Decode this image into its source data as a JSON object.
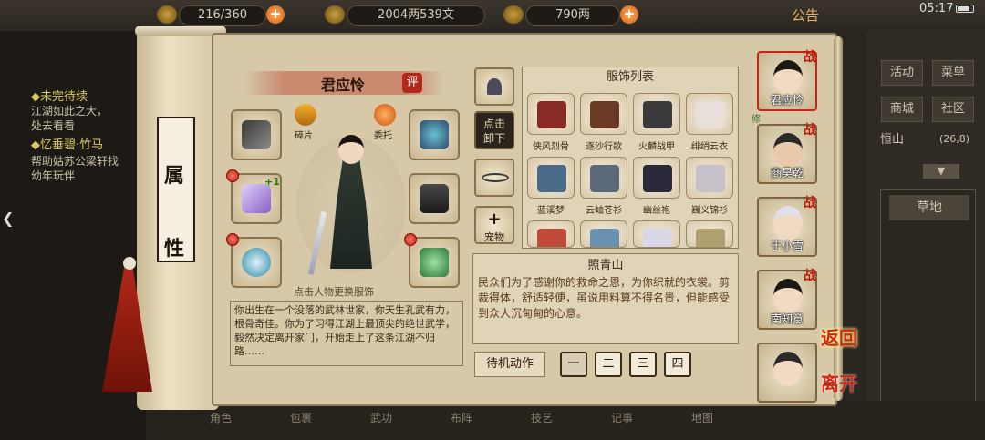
{
  "topbar": {
    "stamina": "216/360",
    "money": "2004两539文",
    "gold": "790两",
    "notice": "公告",
    "clock": "05:17"
  },
  "left_panel": {
    "quest_head_1": "◆未完待续",
    "quest_line_1": "江湖如此之大，",
    "quest_line_2": "处去看看",
    "quest_head_2": "◆忆垂碧·竹马",
    "quest_line_3": "帮助姑苏公梁轩找",
    "quest_line_4": "幼年玩伴"
  },
  "right_panel": {
    "buttons": [
      "活动",
      "菜单",
      "商城",
      "社区"
    ],
    "location": "恒山",
    "coords": "(26,8)",
    "map_item": "草地"
  },
  "bottom_bar": {
    "items": [
      "角色",
      "包裹",
      "武功",
      "布阵",
      "技艺",
      "记事",
      "地图"
    ]
  },
  "scroll": {
    "title_top": "属",
    "title_bottom": "性"
  },
  "character": {
    "name": "君应怜",
    "rate_badge": "评",
    "shards_label": "碎片",
    "entrust_label": "委托",
    "plus_one": "+1",
    "hint": "点击人物更换服饰",
    "description": "你出生在一个没落的武林世家，你天生孔武有力，根骨奇佳。你为了习得江湖上最顶尖的绝世武学，毅然决定离开家门，开始走上了这条江湖不归路……"
  },
  "side_buttons": {
    "unequip": "点击\n卸下",
    "pet": "宠物"
  },
  "clothing": {
    "title": "服饰列表",
    "items": [
      "侠风烈骨",
      "逐沙行歌",
      "火麟战甲",
      "绯绡云衣",
      "蓝溪梦",
      "云岫苍衫",
      "幽丝袍",
      "巍义锦衫"
    ],
    "colors": [
      "#8a2a24",
      "#6a3a24",
      "#3a3a3a",
      "#e8e0d8",
      "#4a6a8a",
      "#5a6a7a",
      "#2a2a3a",
      "#c8c0c8",
      "#c04a3a",
      "#6a90b0",
      "#d8d8e8",
      "#b0a070"
    ]
  },
  "selected_item": {
    "name": "照青山",
    "description": "民众们为了感谢你的救命之恩，为你织就的衣裳。剪裁得体，舒适轻便，虽说用料算不得名贵，但能感受到众人沉甸甸的心意。"
  },
  "idle_actions": {
    "label": "待机动作",
    "options": [
      "一",
      "二",
      "三",
      "四"
    ]
  },
  "team": [
    {
      "name": "君应怜",
      "tag": "修",
      "battle": "战"
    },
    {
      "name": "商昊乾",
      "battle": "战"
    },
    {
      "name": "于小雪",
      "battle": "战"
    },
    {
      "name": "南知意",
      "battle": "战"
    },
    {
      "name": ""
    }
  ],
  "actions": {
    "back": "返回",
    "leave": "离开"
  }
}
